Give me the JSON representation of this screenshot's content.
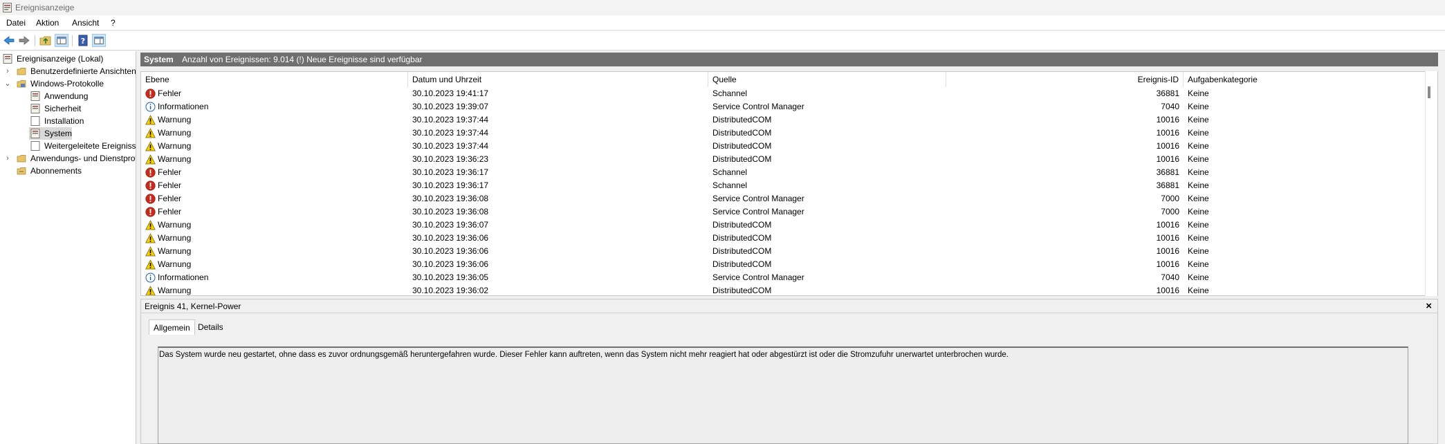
{
  "window": {
    "title": "Ereignisanzeige"
  },
  "menu": [
    "Datei",
    "Aktion",
    "Ansicht",
    "?"
  ],
  "toolbar": {
    "icons": [
      "back-arrow-icon",
      "forward-arrow-icon",
      "folder-up-icon",
      "show-hide-tree-icon",
      "help-icon",
      "show-action-pane-icon"
    ]
  },
  "tree": {
    "root": "Ereignisanzeige (Lokal)",
    "custom_views": "Benutzerdefinierte Ansichten",
    "windows_logs": "Windows-Protokolle",
    "logs": [
      "Anwendung",
      "Sicherheit",
      "Installation",
      "System",
      "Weitergeleitete Ereignisse"
    ],
    "app_services": "Anwendungs- und Dienstprotokolle",
    "subscriptions": "Abonnements"
  },
  "header": {
    "title": "System",
    "subtitle": "Anzahl von Ereignissen: 9.014 (!) Neue Ereignisse sind verfügbar"
  },
  "columns": {
    "level": "Ebene",
    "datetime": "Datum und Uhrzeit",
    "source": "Quelle",
    "event_id": "Ereignis-ID",
    "category": "Aufgabenkategorie"
  },
  "events": [
    {
      "level": "Fehler",
      "type": "error",
      "datetime": "30.10.2023 19:41:17",
      "source": "Schannel",
      "id": "36881",
      "category": "Keine"
    },
    {
      "level": "Informationen",
      "type": "info",
      "datetime": "30.10.2023 19:39:07",
      "source": "Service Control Manager",
      "id": "7040",
      "category": "Keine"
    },
    {
      "level": "Warnung",
      "type": "warning",
      "datetime": "30.10.2023 19:37:44",
      "source": "DistributedCOM",
      "id": "10016",
      "category": "Keine"
    },
    {
      "level": "Warnung",
      "type": "warning",
      "datetime": "30.10.2023 19:37:44",
      "source": "DistributedCOM",
      "id": "10016",
      "category": "Keine"
    },
    {
      "level": "Warnung",
      "type": "warning",
      "datetime": "30.10.2023 19:37:44",
      "source": "DistributedCOM",
      "id": "10016",
      "category": "Keine"
    },
    {
      "level": "Warnung",
      "type": "warning",
      "datetime": "30.10.2023 19:36:23",
      "source": "DistributedCOM",
      "id": "10016",
      "category": "Keine"
    },
    {
      "level": "Fehler",
      "type": "error",
      "datetime": "30.10.2023 19:36:17",
      "source": "Schannel",
      "id": "36881",
      "category": "Keine"
    },
    {
      "level": "Fehler",
      "type": "error",
      "datetime": "30.10.2023 19:36:17",
      "source": "Schannel",
      "id": "36881",
      "category": "Keine"
    },
    {
      "level": "Fehler",
      "type": "error",
      "datetime": "30.10.2023 19:36:08",
      "source": "Service Control Manager",
      "id": "7000",
      "category": "Keine"
    },
    {
      "level": "Fehler",
      "type": "error",
      "datetime": "30.10.2023 19:36:08",
      "source": "Service Control Manager",
      "id": "7000",
      "category": "Keine"
    },
    {
      "level": "Warnung",
      "type": "warning",
      "datetime": "30.10.2023 19:36:07",
      "source": "DistributedCOM",
      "id": "10016",
      "category": "Keine"
    },
    {
      "level": "Warnung",
      "type": "warning",
      "datetime": "30.10.2023 19:36:06",
      "source": "DistributedCOM",
      "id": "10016",
      "category": "Keine"
    },
    {
      "level": "Warnung",
      "type": "warning",
      "datetime": "30.10.2023 19:36:06",
      "source": "DistributedCOM",
      "id": "10016",
      "category": "Keine"
    },
    {
      "level": "Warnung",
      "type": "warning",
      "datetime": "30.10.2023 19:36:06",
      "source": "DistributedCOM",
      "id": "10016",
      "category": "Keine"
    },
    {
      "level": "Informationen",
      "type": "info",
      "datetime": "30.10.2023 19:36:05",
      "source": "Service Control Manager",
      "id": "7040",
      "category": "Keine"
    },
    {
      "level": "Warnung",
      "type": "warning",
      "datetime": "30.10.2023 19:36:02",
      "source": "DistributedCOM",
      "id": "10016",
      "category": "Keine"
    }
  ],
  "detail": {
    "title": "Ereignis 41, Kernel-Power",
    "close": "×",
    "tabs": [
      "Allgemein",
      "Details"
    ],
    "message": "Das System wurde neu gestartet, ohne dass es zuvor ordnungsgemäß heruntergefahren wurde. Dieser Fehler kann auftreten, wenn das System nicht mehr reagiert hat oder abgestürzt ist oder die Stromzufuhr unerwartet unterbrochen wurde."
  },
  "colors": {
    "header_bar": "#6f6f6f",
    "error": "#c42b1c",
    "warning": "#f5d000",
    "info": "#1f5fa8",
    "selection": "#d9d9d9"
  }
}
